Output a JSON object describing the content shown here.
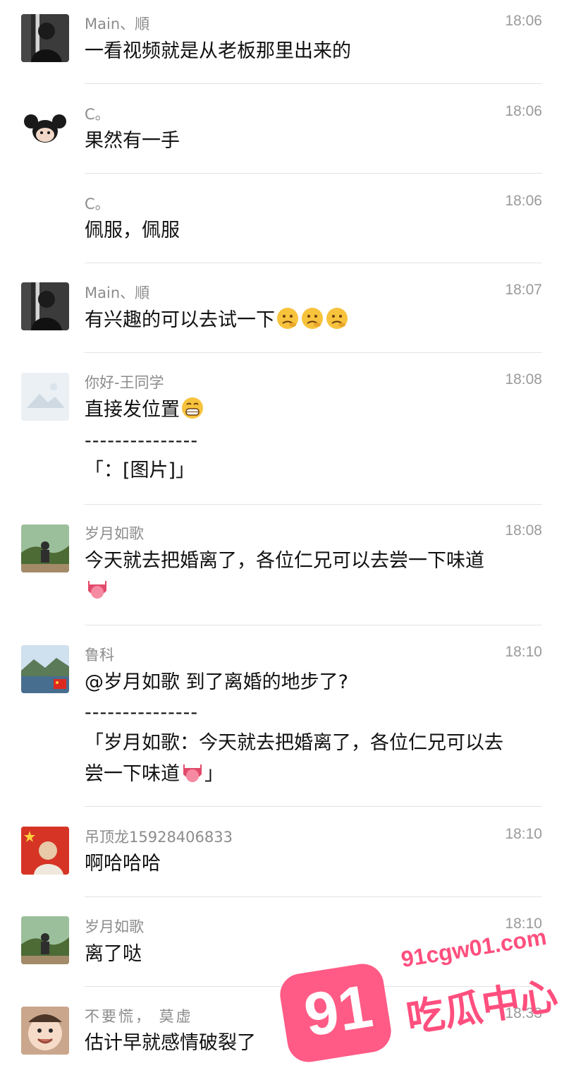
{
  "messages": [
    {
      "id": 1,
      "name": "Main、順",
      "time": "18:06",
      "avatar": "portrait-bw-avatar",
      "lines": [
        "一看视频就是从老板那里出来的"
      ]
    },
    {
      "id": 2,
      "name": "C。",
      "time": "18:06",
      "avatar": "mickey-avatar",
      "lines": [
        "果然有一手"
      ]
    },
    {
      "id": 3,
      "name": "C。",
      "time": "18:06",
      "avatar": "",
      "lines": [
        "佩服，佩服"
      ]
    },
    {
      "id": 4,
      "name": "Main、順",
      "time": "18:07",
      "avatar": "portrait-bw-avatar",
      "lines": [
        "有兴趣的可以去试一下"
      ],
      "emoji": [
        "thinking-face-icon",
        "thinking-face-icon",
        "thinking-face-icon"
      ]
    },
    {
      "id": 5,
      "name": "你好-王同学",
      "time": "18:08",
      "avatar": "placeholder-landscape-avatar",
      "lines": [
        "直接发位置",
        "---------------",
        "「：[图片]」"
      ],
      "emoji": [
        "grinning-face-icon"
      ]
    },
    {
      "id": 6,
      "name": "岁月如歌",
      "time": "18:08",
      "avatar": "nature-avatar",
      "lines": [
        "今天就去把婚离了，各位仁兄可以去尝一下味道"
      ],
      "emoji": [
        "tongue-face-icon"
      ]
    },
    {
      "id": 7,
      "name": "鲁科",
      "time": "18:10",
      "avatar": "lake-avatar",
      "lines": [
        "@岁月如歌 到了离婚的地步了?",
        "---------------",
        "「岁月如歌：今天就去把婚离了，各位仁兄可以去",
        "尝一下味道",
        "」"
      ],
      "emoji": [
        "tongue-face-icon"
      ]
    },
    {
      "id": 8,
      "name": "吊顶龙15928406833",
      "time": "18:10",
      "avatar": "child-flag-avatar",
      "lines": [
        "啊哈哈哈"
      ]
    },
    {
      "id": 9,
      "name": "岁月如歌",
      "time": "18:10",
      "avatar": "nature-avatar",
      "lines": [
        "离了哒"
      ]
    },
    {
      "id": 10,
      "name": "不要慌， 莫虚",
      "time": "18:33",
      "avatar": "baby-avatar",
      "lines": [
        "估计早就感情破裂了"
      ]
    }
  ],
  "watermark": {
    "number": "91",
    "url": "91cgw01.com",
    "brand": "吃瓜中心"
  },
  "colors": {
    "name": "#8c8c8c",
    "time": "#9a9a9a",
    "text": "#111111",
    "divider": "#e3e3e3",
    "watermark": "#ff5b86"
  }
}
